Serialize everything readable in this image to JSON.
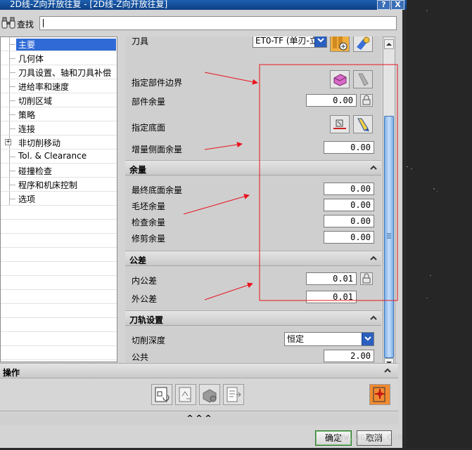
{
  "window": {
    "title": "2D线-Z向开放往复 - [2D线-Z向开放往复]",
    "help_label": "?",
    "close_label": "X"
  },
  "search": {
    "label": "查找",
    "value": ""
  },
  "tree": {
    "items": [
      {
        "label": "主要",
        "selected": true
      },
      {
        "label": "几何体"
      },
      {
        "label": "刀具设置、轴和刀具补偿"
      },
      {
        "label": "进给率和速度"
      },
      {
        "label": "切削区域"
      },
      {
        "label": "策略"
      },
      {
        "label": "连接"
      },
      {
        "label": "非切削移动",
        "expandable": true,
        "expander": "+"
      },
      {
        "label": "Tol. & Clearance"
      },
      {
        "label": "碰撞检查"
      },
      {
        "label": "程序和机床控制"
      },
      {
        "label": "选项"
      }
    ]
  },
  "main": {
    "tool_label": "刀具",
    "tool_value": "ET0-TF (单刃-立",
    "specify_part_boundary_label": "指定部件边界",
    "part_stock_label": "部件余量",
    "part_stock_value": "0.00",
    "specify_floor_label": "指定底面",
    "incremental_side_stock_label": "增量侧面余量",
    "incremental_side_stock_value": "0.00"
  },
  "stock_group": {
    "title": "余量",
    "rows": [
      {
        "label": "最终底面余量",
        "value": "0.00"
      },
      {
        "label": "毛坯余量",
        "value": "0.00"
      },
      {
        "label": "检查余量",
        "value": "0.00"
      },
      {
        "label": "修剪余量",
        "value": "0.00"
      }
    ]
  },
  "tolerance_group": {
    "title": "公差",
    "intol_label": "内公差",
    "intol_value": "0.01",
    "outtol_label": "外公差",
    "outtol_value": "0.01"
  },
  "toolpath_group": {
    "title": "刀轨设置",
    "cut_depth_label": "切削深度",
    "cut_depth_value": "恒定",
    "common_label": "公共",
    "common_value": "2.00"
  },
  "operations": {
    "title": "操作",
    "more_label": "^ ^ ^"
  },
  "buttons": {
    "ok": "确定",
    "cancel": "取消"
  },
  "watermark": "WWW.UGSNX.COM",
  "colors": {
    "selection": "#2f6ad6",
    "annotation_red": "#e8141e",
    "scroll_thumb": "#7ab0e8"
  }
}
